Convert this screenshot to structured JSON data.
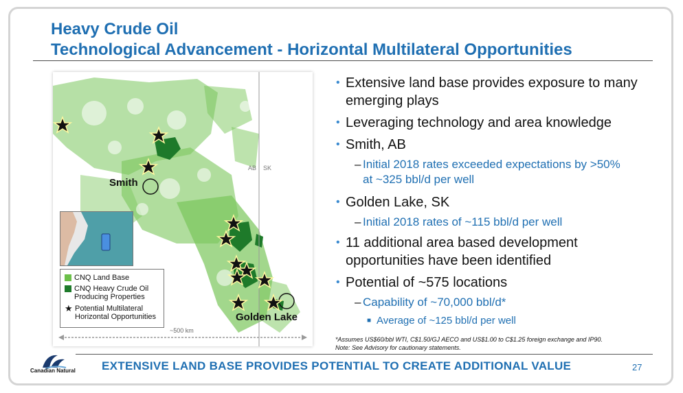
{
  "header": {
    "title_line1": "Heavy Crude Oil",
    "title_line2": "Technological Advancement - Horizontal Multilateral Opportunities"
  },
  "map": {
    "labels": {
      "smith": "Smith",
      "golden_lake": "Golden Lake",
      "ab": "AB",
      "sk": "SK",
      "scale": "~500 km"
    },
    "legend": {
      "land_base": "CNQ Land Base",
      "heavy_crude": "CNQ Heavy Crude Oil Producing Properties",
      "opportunities": "Potential Multilateral Horizontal Opportunities"
    },
    "colors": {
      "land_base": "#6cc04a",
      "heavy_crude": "#1e7a2a",
      "star": "#111111"
    }
  },
  "bullets": {
    "b1": "Extensive land base provides exposure to many emerging plays",
    "b2": "Leveraging technology and area knowledge",
    "b3": "Smith, AB",
    "b3_sub": "Initial 2018 rates exceeded expectations by >50% at ~325 bbl/d per well",
    "b4": "Golden Lake, SK",
    "b4_sub": "Initial 2018 rates of ~115 bbl/d per well",
    "b5": "11 additional area based development opportunities have been identified",
    "b6": "Potential of ~575 locations",
    "b6_sub": "Capability of ~70,000 bbl/d*",
    "b6_subsub": "Average of ~125 bbl/d per well"
  },
  "footnote": {
    "line1": "*Assumes US$60/bbl WTI, C$1.50/GJ AECO and US$1.00 to C$1.25 foreign exchange and IP90.",
    "line2": "Note: See Advisory for cautionary statements."
  },
  "footer": {
    "banner": "EXTENSIVE LAND BASE PROVIDES POTENTIAL TO CREATE ADDITIONAL VALUE",
    "page_number": "27",
    "logo_text": "Canadian Natural"
  },
  "theme": {
    "accent": "#1f6fb2"
  }
}
